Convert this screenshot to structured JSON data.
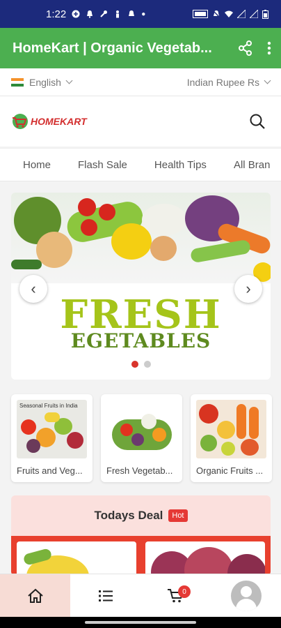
{
  "status": {
    "time": "1:22"
  },
  "app_bar": {
    "title": "HomeKart | Organic Vegetab..."
  },
  "lang_bar": {
    "language": "English",
    "currency": "Indian Rupee Rs"
  },
  "logo": {
    "text": "HOMEKART"
  },
  "nav": {
    "items": [
      "Home",
      "Flash Sale",
      "Health Tips",
      "All Bran"
    ]
  },
  "banner": {
    "headline": "FRESH",
    "subline": "EGETABLES",
    "slides": 2,
    "active_slide": 1
  },
  "categories": [
    {
      "label": "Fruits and Veg...",
      "image_caption": "Seasonal Fruits in India"
    },
    {
      "label": "Fresh Vegetab..."
    },
    {
      "label": "Organic Fruits ..."
    }
  ],
  "deal": {
    "title": "Todays Deal",
    "badge": "Hot"
  },
  "bottom_nav": {
    "cart_count": "0"
  },
  "colors": {
    "app_bar": "#4caf50",
    "status_bar": "#1c2a7c",
    "accent": "#e53935",
    "deal_bg": "#fbe0dd"
  }
}
